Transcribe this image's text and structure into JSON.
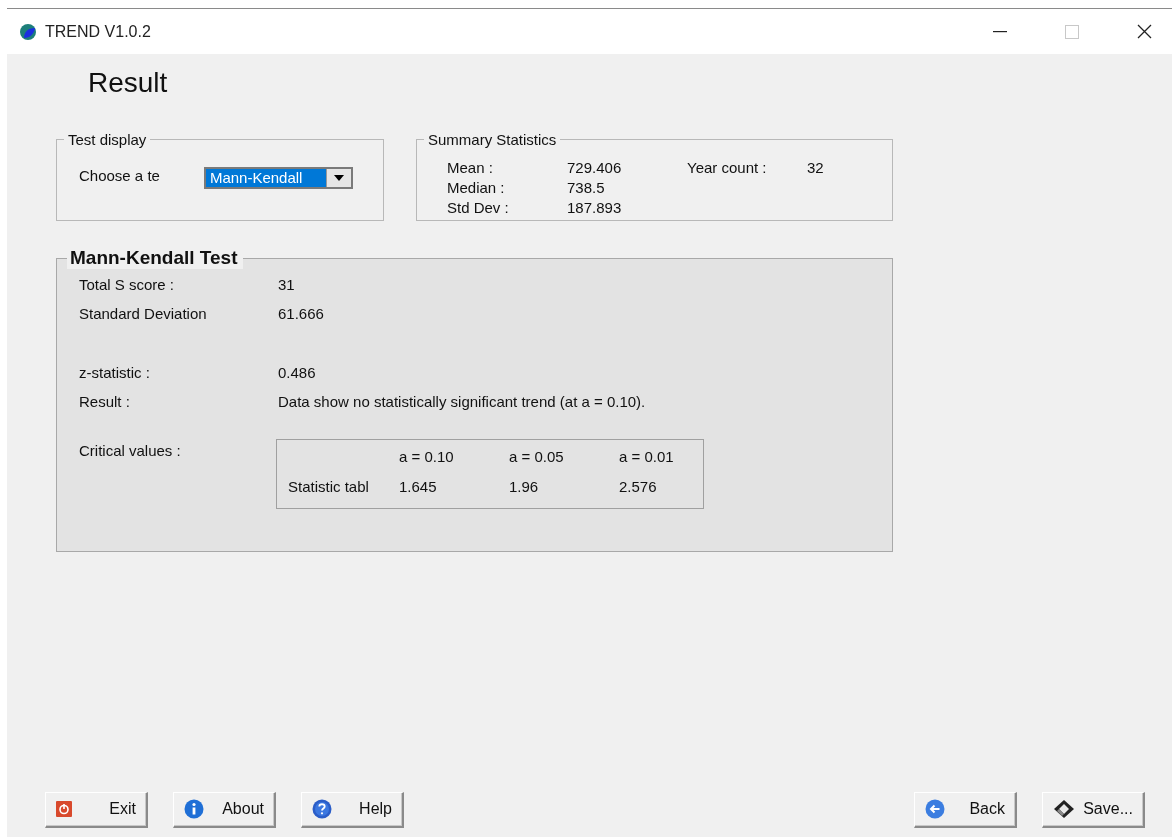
{
  "window": {
    "title": "TREND V1.0.2"
  },
  "heading": "Result",
  "test_display": {
    "legend": "Test display",
    "label": "Choose  a te",
    "dropdown": {
      "value": "Mann-Kendall",
      "focused": true
    }
  },
  "summary": {
    "legend": "Summary Statistics",
    "columns": [
      [
        {
          "label": "Mean :",
          "value": "729.406"
        },
        {
          "label": "Median :",
          "value": "738.5"
        },
        {
          "label": "Std Dev :",
          "value": "187.893"
        }
      ],
      [
        {
          "label": "Year count :",
          "value": "32"
        }
      ]
    ]
  },
  "test_panel": {
    "title": "Mann-Kendall Test",
    "groups": [
      [
        {
          "label": "Total S score  :",
          "value": "31"
        },
        {
          "label": "Standard Deviation",
          "value": "61.666"
        }
      ],
      [
        {
          "label": "z-statistic :",
          "value": "0.486"
        },
        {
          "label": "Result :",
          "value": "Data show no statistically significant trend (at a = 0.10)."
        }
      ]
    ],
    "critical_label": "Critical values :",
    "table": {
      "columns": [
        "a = 0.10",
        "a = 0.05",
        "a = 0.01"
      ],
      "row_label": "Statistic tabl",
      "values": [
        "1.645",
        "1.96",
        "2.576"
      ]
    }
  },
  "buttons_left": [
    {
      "kind": "exit",
      "label": "Exit"
    },
    {
      "kind": "about",
      "label": "About"
    },
    {
      "kind": "help",
      "label": "Help"
    }
  ],
  "buttons_right": [
    {
      "kind": "back",
      "label": "Back"
    },
    {
      "kind": "save",
      "label": "Save..."
    }
  ]
}
